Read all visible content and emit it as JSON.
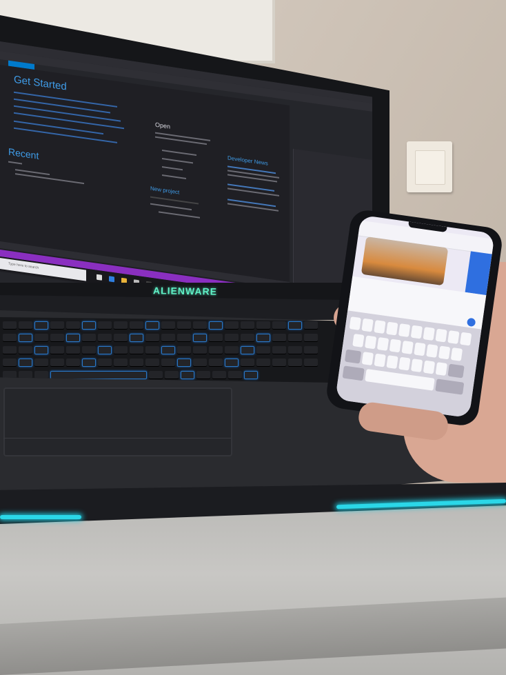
{
  "scene": {
    "laptop": {
      "brand_logo": "ALIENWARE",
      "screen_app": {
        "heading_get_started": "Get Started",
        "heading_recent": "Recent",
        "heading_open": "Open",
        "heading_developer_news": "Developer News",
        "heading_new_project": "New project",
        "taskbar_search_placeholder": "Type here to search"
      }
    },
    "phone": {
      "app": "messaging"
    },
    "colors": {
      "logo_glow": "#5ff0c6",
      "accent_light": "#2bd7e8",
      "ide_accent": "#3f9ce8",
      "status_bar": "#8a2fc0"
    }
  }
}
